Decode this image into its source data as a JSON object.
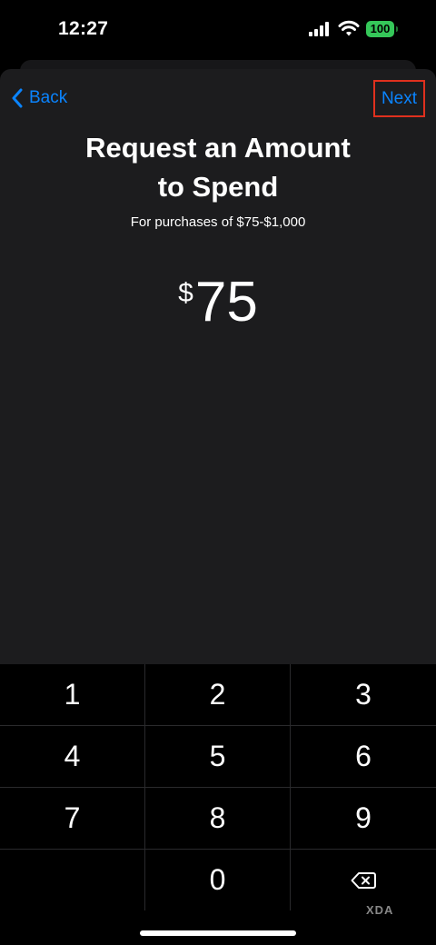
{
  "status_bar": {
    "time": "12:27",
    "battery": "100",
    "icons": [
      "signal-icon",
      "wifi-icon",
      "battery-icon"
    ]
  },
  "nav": {
    "back_label": "Back",
    "next_label": "Next"
  },
  "header": {
    "title_line1": "Request an Amount",
    "title_line2": "to Spend",
    "subtitle": "For purchases of $75-$1,000"
  },
  "amount": {
    "currency": "$",
    "value": "75"
  },
  "keypad": {
    "keys": [
      "1",
      "2",
      "3",
      "4",
      "5",
      "6",
      "7",
      "8",
      "9",
      "",
      "0",
      "delete"
    ]
  },
  "watermark": "XDA",
  "colors": {
    "accent": "#0a84ff",
    "highlight_border": "#e0301e",
    "battery": "#35c759",
    "sheet": "#1c1c1e"
  }
}
